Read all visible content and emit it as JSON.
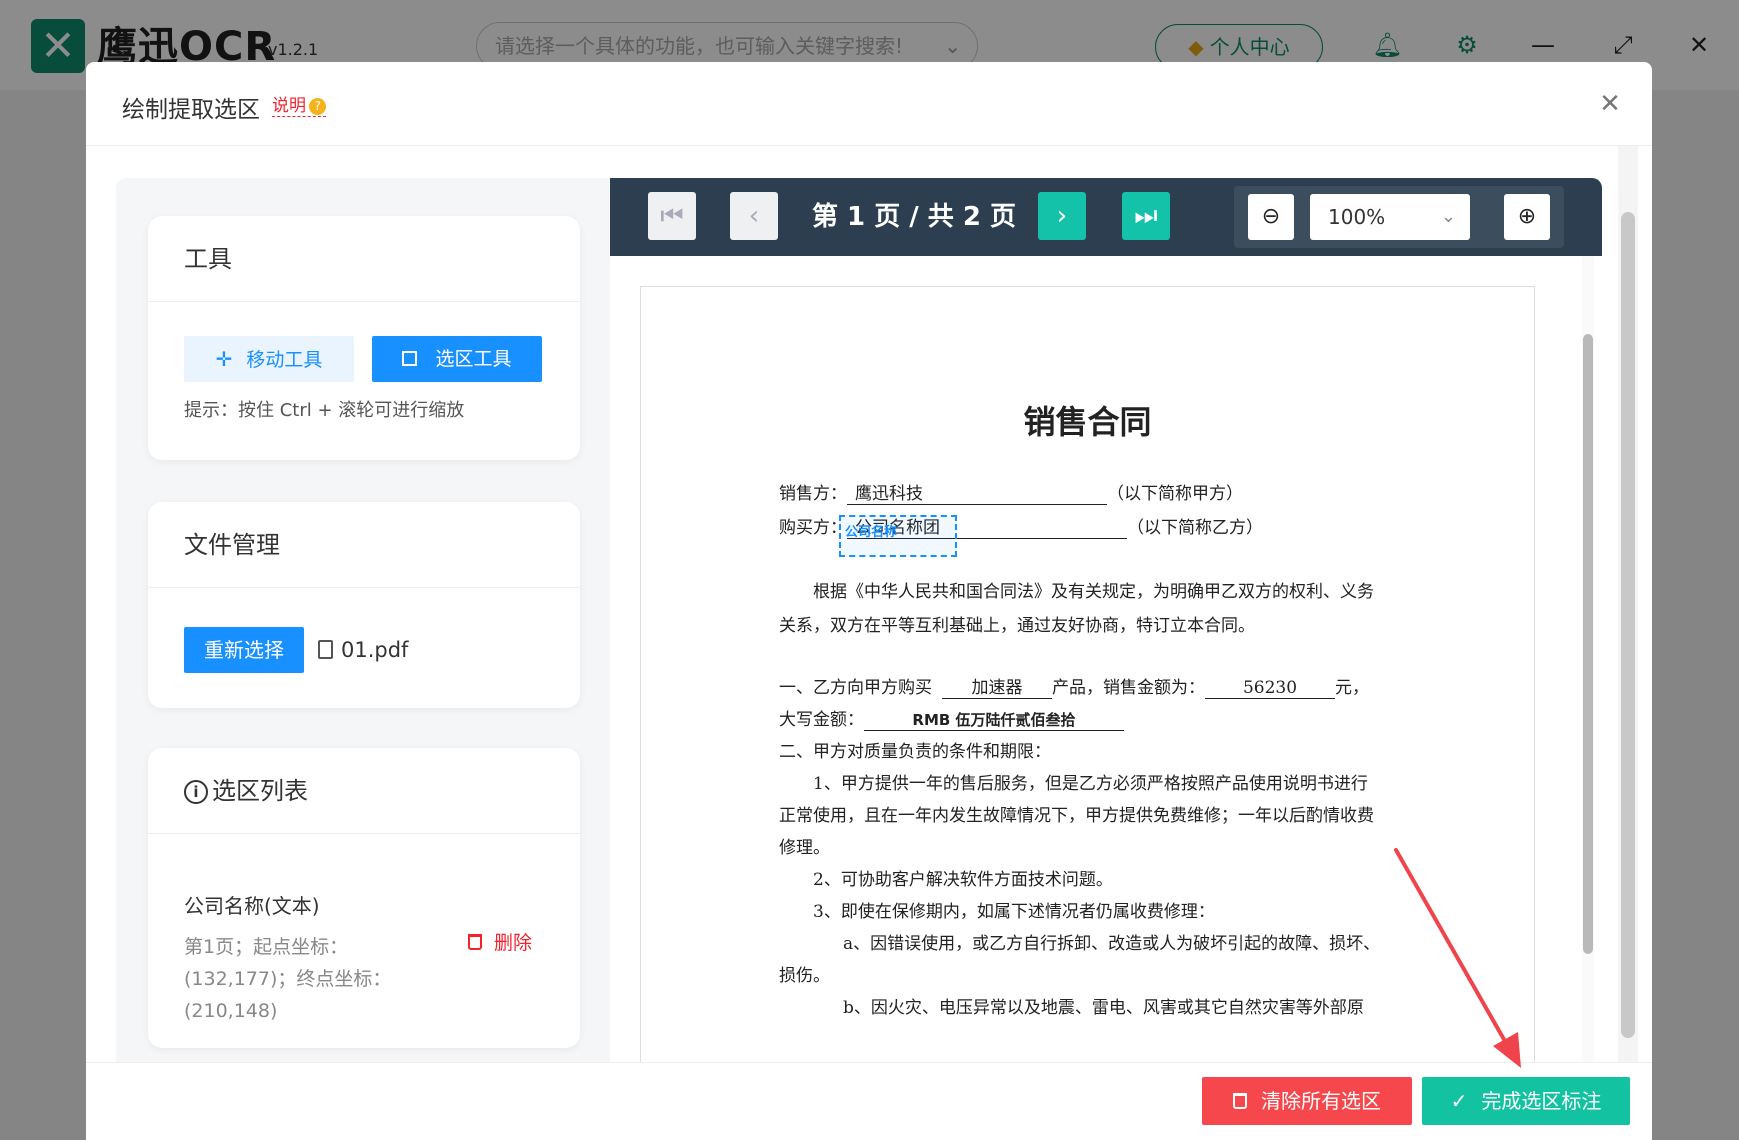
{
  "app": {
    "logo_mark": "✕",
    "name": "鹰迅OCR",
    "version": "v1.2.1",
    "search_placeholder": "请选择一个具体的功能，也可输入关键字搜索!",
    "personal_center": "个人中心"
  },
  "modal": {
    "title": "绘制提取选区",
    "help_link": "说明",
    "help_icon": "?",
    "close": "✕"
  },
  "tools": {
    "title": "工具",
    "move_tool": "移动工具",
    "select_tool": "选区工具",
    "hint": "提示：按住 Ctrl + 滚轮可进行缩放"
  },
  "files": {
    "title": "文件管理",
    "reselect": "重新选择",
    "file_name": "01.pdf"
  },
  "selections": {
    "title": "选区列表",
    "items": [
      {
        "name": "公司名称(文本)",
        "coords": "第1页；起点坐标：(132,177)；终点坐标：(210,148)",
        "delete": "删除"
      }
    ]
  },
  "viewer": {
    "page_indicator": "第 1 页 / 共 2 页",
    "zoom": "100%"
  },
  "document": {
    "title": "销售合同",
    "seller_label": "销售方：",
    "seller": "鹰迅科技",
    "seller_note": "（以下简称甲方）",
    "buyer_label": "购买方：",
    "buyer": "公司名称团",
    "buyer_note": "（以下简称乙方）",
    "selection_label": "公司名称",
    "p1": "根据《中华人民共和国合同法》及有关规定，为明确甲乙双方的权利、义务",
    "p2": "关系，双方在平等互利基础上，通过友好协商，特订立本合同。",
    "item1_a": "一、乙方向甲方购买",
    "item1_product": "加速器",
    "item1_b": "产品，销售金额为：",
    "item1_amount": "56230",
    "item1_c": "元，",
    "item1_upper_label": "大写金额：",
    "item1_upper": "RMB 伍万陆仟贰佰叁拾",
    "item2": "二、甲方对质量负责的条件和期限：",
    "item2_1a": "1、甲方提供一年的售后服务，但是乙方必须严格按照产品使用说明书进行",
    "item2_1b": "正常使用，且在一年内发生故障情况下，甲方提供免费维修；一年以后酌情收费",
    "item2_1c": "修理。",
    "item2_2": "2、可协助客户解决软件方面技术问题。",
    "item2_3": "3、即使在保修期内，如属下述情况者仍属收费修理：",
    "item2_3a": "a、因错误使用，或乙方自行拆卸、改造或人为破坏引起的故障、损坏、",
    "item2_3a2": "损伤。",
    "item2_3b": "b、因火灾、电压异常以及地震、雷电、风害或其它自然灾害等外部原"
  },
  "footer": {
    "clear_all": "清除所有选区",
    "done": "完成选区标注"
  },
  "colors": {
    "primary_blue": "#1890ff",
    "teal": "#13c2a0",
    "danger": "#f5474c",
    "toolbar_dark": "#2c3e50",
    "brand_green": "#0f8a6c",
    "annotation_red": "#f0444c"
  }
}
